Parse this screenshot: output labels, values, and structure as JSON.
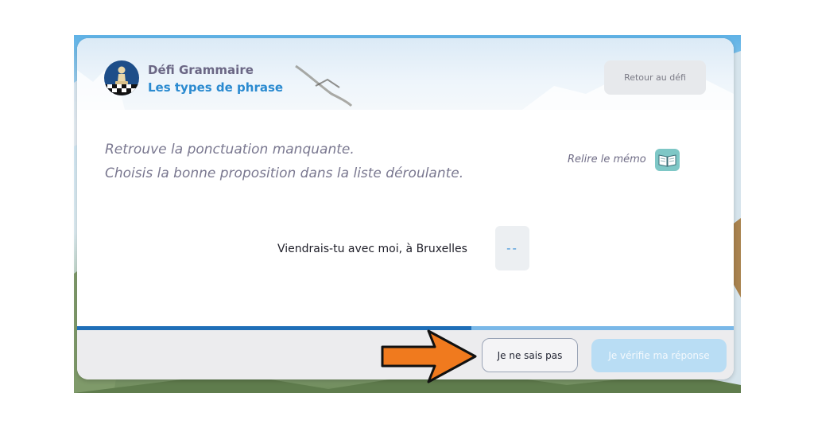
{
  "header": {
    "title": "Défi Grammaire",
    "subtitle": "Les types de phrase",
    "back_button_label": "Retour au défi",
    "avatar_icon": "chess-pawn-icon"
  },
  "instructions": {
    "line1": "Retrouve la ponctuation manquante.",
    "line2": "Choisis la bonne proposition dans la liste déroulante."
  },
  "memo": {
    "label": "Relire le mémo",
    "icon": "open-book-icon"
  },
  "exercise": {
    "sentence": "Viendrais-tu avec moi, à Bruxelles",
    "selected_value": "--"
  },
  "progress": {
    "value": 0.6
  },
  "footer": {
    "skip_label": "Je ne sais pas",
    "verify_label": "Je vérifie ma réponse"
  },
  "colors": {
    "accent": "#2a8ad0",
    "arrow": "#f07a1e"
  }
}
